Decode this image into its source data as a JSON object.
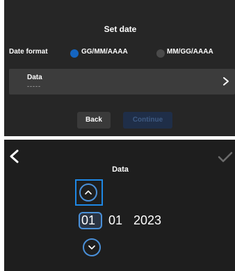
{
  "dialog": {
    "title": "Set date",
    "date_format_label": "Date format",
    "options": [
      "GG/MM/AAAA",
      "MM/GG/AAAA"
    ],
    "selected_option": "GG/MM/AAAA",
    "date_field": {
      "label": "Data",
      "value": "-----"
    },
    "back_label": "Back",
    "continue_label": "Continue"
  },
  "picker": {
    "title": "Data",
    "day": "01",
    "month": "01",
    "year": "2023"
  },
  "colors": {
    "accent": "#1e88e5",
    "panel": "#262626",
    "row": "#3c3c3c"
  },
  "icons": [
    "chevron-right-icon",
    "back-arrow-icon",
    "check-icon",
    "chevron-up-icon",
    "chevron-down-icon"
  ]
}
